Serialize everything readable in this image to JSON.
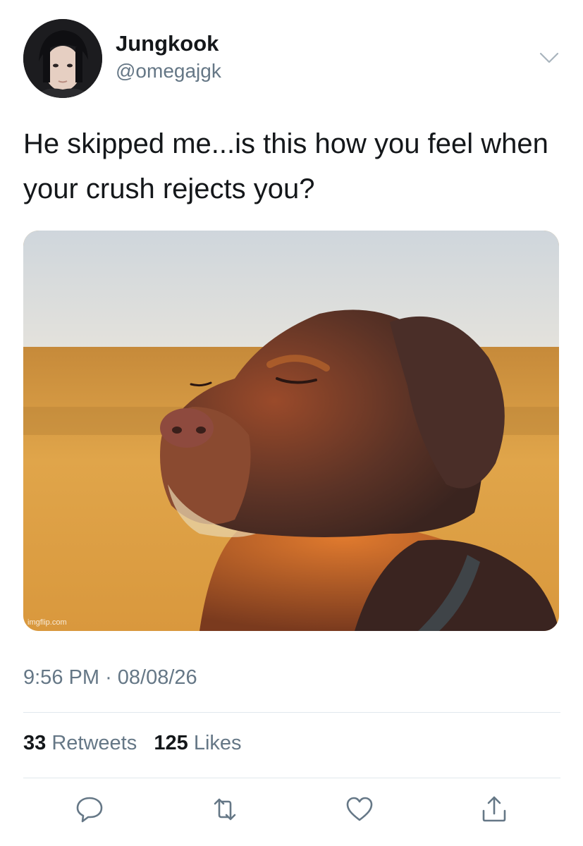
{
  "user": {
    "display_name": "Jungkook",
    "handle": "@omegajgk",
    "avatar_icon": "profile-photo"
  },
  "tweet": {
    "text": "He skipped me...is this how you feel when your crush rejects you?",
    "media_watermark": "imgflip.com",
    "time": "9:56 PM",
    "separator": "·",
    "date": "08/08/26"
  },
  "stats": {
    "retweets_count": "33",
    "retweets_label": "Retweets",
    "likes_count": "125",
    "likes_label": "Likes"
  },
  "actions": {
    "icons": [
      "reply-icon",
      "retweet-icon",
      "like-icon",
      "share-icon"
    ]
  },
  "colors": {
    "text_primary": "#14171a",
    "text_secondary": "#657786",
    "divider": "#e1e8ed",
    "icon": "#657786"
  }
}
